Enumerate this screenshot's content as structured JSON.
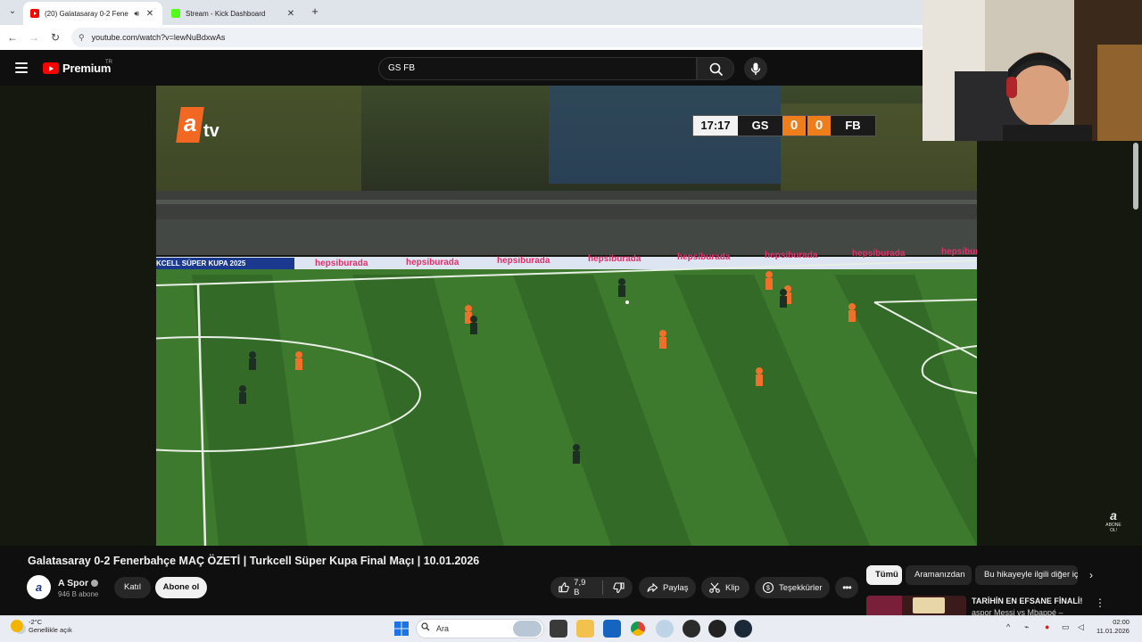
{
  "browser": {
    "tabs": [
      {
        "title": "(20) Galatasaray 0-2 Fenerba",
        "active": true
      },
      {
        "title": "Stream - Kick Dashboard",
        "active": false
      }
    ],
    "url": "youtube.com/watch?v=lewNuBdxwAs"
  },
  "youtube": {
    "logo_text": "Premium",
    "region": "TR",
    "search_value": "GS FB"
  },
  "video": {
    "broadcaster": {
      "a": "a",
      "tv": "tv"
    },
    "scoreboard": {
      "clock": "17:17",
      "home": "GS",
      "home_score": "0",
      "away_score": "0",
      "away": "FB"
    },
    "ads": [
      "hepsiburada",
      "hepsiburada",
      "hepsiburada",
      "hepsiburada",
      "hepsiburada",
      "hepsiburada",
      "hepsiburada",
      "hepsiburada"
    ],
    "board_left": "KCELL SÜPER KUPA 2025",
    "watermark": {
      "letter": "a",
      "sub": "ABONE OL!"
    },
    "colors": {
      "pitch_light": "#3d7a2e",
      "pitch_dark": "#346a27",
      "score_accent": "#ee7d1b"
    }
  },
  "details": {
    "title": "Galatasaray 0-2 Fenerbahçe MAÇ ÖZETİ | Turkcell Süper Kupa Final Maçı | 10.01.2026",
    "channel": {
      "name": "A Spor",
      "subscribers": "946 B abone",
      "avatar_letter": "a"
    },
    "join_label": "Katıl",
    "subscribe_label": "Abone ol",
    "likes": "7,9 B",
    "share_label": "Paylaş",
    "clip_label": "Klip",
    "thanks_label": "Teşekkürler"
  },
  "chips": [
    "Tümü",
    "Aramanızdan",
    "Bu hikayeyle ilgili diğer iç"
  ],
  "recommendation": {
    "title": "TARİHİN EN EFSANE FİNALİ!",
    "subtitle": "aspor Messi vs Mbappé –"
  },
  "taskbar": {
    "temperature": "-2°C",
    "weather": "Genellikle açık",
    "search_placeholder": "Ara",
    "time": "02:00",
    "date": "11.01.2026"
  }
}
